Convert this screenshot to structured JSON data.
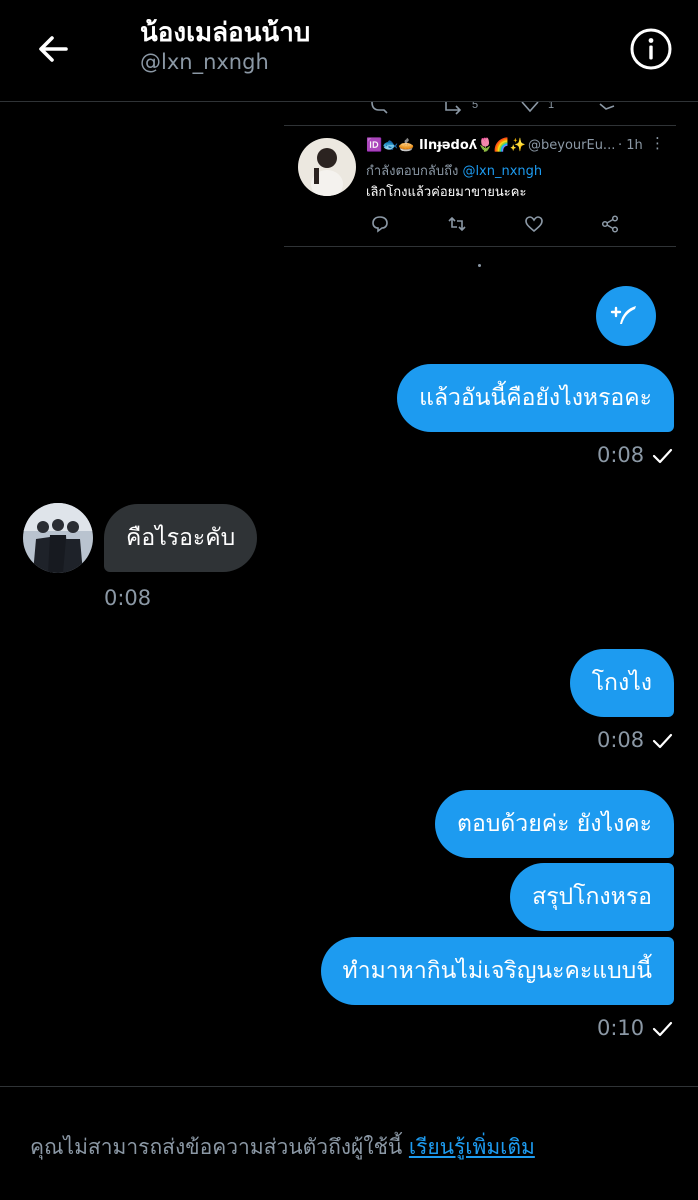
{
  "header": {
    "title": "น้องเมล่อนน้าบ",
    "handle": "@lxn_nxngh"
  },
  "tweet": {
    "display_name": "🆔🐟🥧 llnɟədoʎ🌷🌈✨",
    "handle": "@beyourEu...",
    "time": "· 1h",
    "reply_prefix": "กำลังตอบกลับถึง",
    "reply_mention": "@lxn_nxngh",
    "text": "เลิกโกงแล้วค่อยมาขายนะคะ"
  },
  "messages": [
    {
      "direction": "out",
      "text": "แล้วอันนี้คือยังไงหรอคะ",
      "time": "0:08"
    },
    {
      "direction": "in",
      "text": "คือไรอะคับ",
      "time": "0:08"
    },
    {
      "direction": "out",
      "text": "โกงไง",
      "time": "0:08"
    },
    {
      "direction": "out",
      "text": "ตอบด้วยค่ะ ยังไงคะ"
    },
    {
      "direction": "out",
      "text": "สรุปโกงหรอ"
    },
    {
      "direction": "out",
      "text": "ทำมาหากินไม่เจริญนะคะแบบนี้",
      "time": "0:10"
    }
  ],
  "footer": {
    "notice": "คุณไม่สามารถส่งข้อความส่วนตัวถึงผู้ใช้นี้",
    "link": "เรียนรู้เพิ่มเติม"
  },
  "colors": {
    "background": "#000000",
    "accent": "#1d9bf0",
    "incoming_bubble": "#2f3336",
    "secondary_text": "#8b98a5"
  },
  "icons": [
    "back-arrow-icon",
    "info-icon",
    "reply-icon",
    "retweet-icon",
    "like-icon",
    "share-icon",
    "compose-icon",
    "sent-check-icon"
  ]
}
